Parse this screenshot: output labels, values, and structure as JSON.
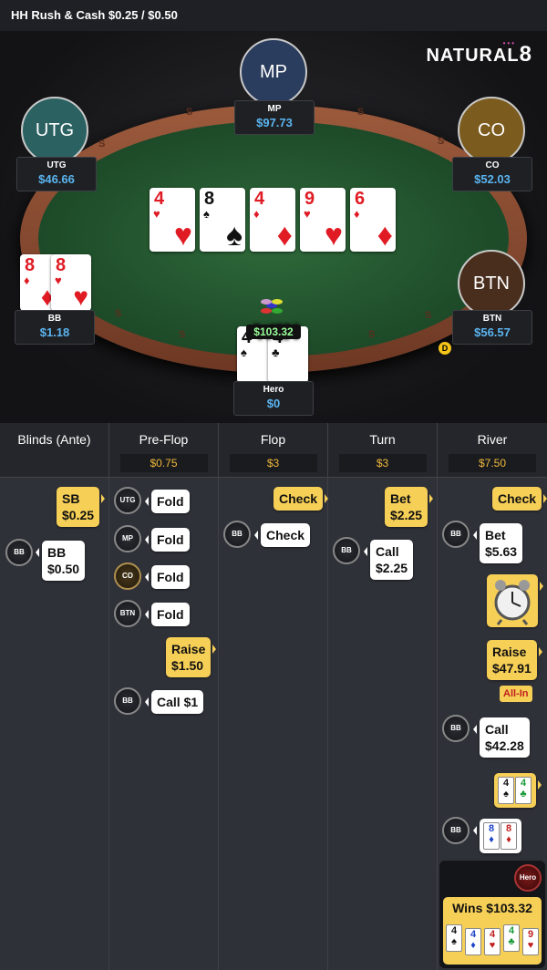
{
  "title": "HH  Rush & Cash $0.25 / $0.50",
  "logo": {
    "text": "NATURAL",
    "digit": "8"
  },
  "rail_letters": [
    "S",
    "S",
    "S",
    "S",
    "S",
    "S",
    "S",
    "S"
  ],
  "seats": {
    "mp": {
      "label": "MP",
      "pos": "MP",
      "stack": "$97.73"
    },
    "utg": {
      "label": "UTG",
      "pos": "UTG",
      "stack": "$46.66"
    },
    "co": {
      "label": "CO",
      "pos": "CO",
      "stack": "$52.03"
    },
    "btn": {
      "label": "BTN",
      "pos": "BTN",
      "stack": "$56.57"
    },
    "bb": {
      "pos": "BB",
      "stack": "$1.18",
      "cards": [
        {
          "rank": "8",
          "suit": "♦"
        },
        {
          "rank": "8",
          "suit": "♥"
        }
      ]
    },
    "hero": {
      "pos": "Hero",
      "stack": "$0",
      "cards": [
        {
          "rank": "4",
          "suit": "♠"
        },
        {
          "rank": "4",
          "suit": "♣"
        }
      ],
      "win": "WIN"
    }
  },
  "dealer_button": "D",
  "board": [
    {
      "rank": "4",
      "suit": "♥"
    },
    {
      "rank": "8",
      "suit": "♠"
    },
    {
      "rank": "4",
      "suit": "♦"
    },
    {
      "rank": "9",
      "suit": "♥"
    },
    {
      "rank": "6",
      "suit": "♦"
    }
  ],
  "pot": "$103.32",
  "streets": [
    {
      "name": "Blinds (Ante)",
      "pot": ""
    },
    {
      "name": "Pre-Flop",
      "pot": "$0.75"
    },
    {
      "name": "Flop",
      "pot": "$3"
    },
    {
      "name": "Turn",
      "pot": "$3"
    },
    {
      "name": "River",
      "pot": "$7.50"
    }
  ],
  "actions": {
    "blinds": {
      "sb_label": "SB",
      "sb_amt": "$0.25",
      "bb_avatar": "BB",
      "bb_label": "BB",
      "bb_amt": "$0.50"
    },
    "preflop": {
      "utg": "UTG",
      "utg_act": "Fold",
      "mp": "MP",
      "mp_act": "Fold",
      "co": "CO",
      "co_act": "Fold",
      "btn": "BTN",
      "btn_act": "Fold",
      "hero_act": "Raise",
      "hero_amt": "$1.50",
      "bb": "BB",
      "bb_act": "Call  $1"
    },
    "flop": {
      "hero_act": "Check",
      "bb": "BB",
      "bb_act": "Check"
    },
    "turn": {
      "hero_act": "Bet",
      "hero_amt": "$2.25",
      "bb": "BB",
      "bb_act": "Call",
      "bb_amt": "$2.25"
    },
    "river": {
      "hero_act": "Check",
      "bb": "BB",
      "bb_act": "Bet",
      "bb_amt": "$5.63",
      "raise_act": "Raise",
      "raise_amt": "$47.91",
      "allin": "All-In",
      "bb2": "BB",
      "call_act": "Call",
      "call_amt": "$42.28",
      "hero_show": [
        {
          "rank": "4",
          "suit": "♠"
        },
        {
          "rank": "4",
          "suit": "♣"
        }
      ],
      "bb3": "BB",
      "bb_show": [
        {
          "rank": "8",
          "suit": "♦"
        },
        {
          "rank": "8",
          "suit": "♦"
        }
      ],
      "hero_tag": "Hero",
      "wins": "Wins $103.32",
      "best_hand": [
        {
          "rank": "4",
          "suit": "♠"
        },
        {
          "rank": "4",
          "suit": "♦"
        },
        {
          "rank": "4",
          "suit": "♥"
        },
        {
          "rank": "4",
          "suit": "♣"
        },
        {
          "rank": "9",
          "suit": "♥"
        }
      ]
    }
  }
}
